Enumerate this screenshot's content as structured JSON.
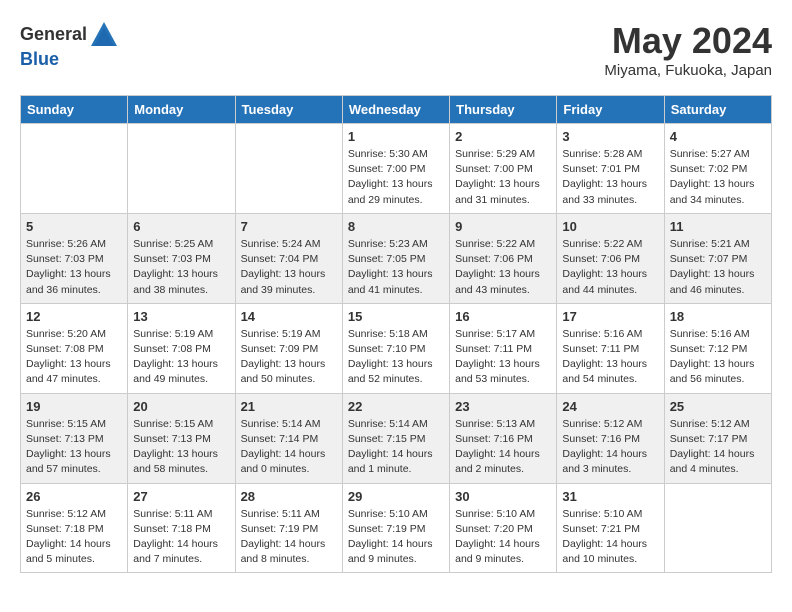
{
  "header": {
    "logo_general": "General",
    "logo_blue": "Blue",
    "month_year": "May 2024",
    "location": "Miyama, Fukuoka, Japan"
  },
  "weekdays": [
    "Sunday",
    "Monday",
    "Tuesday",
    "Wednesday",
    "Thursday",
    "Friday",
    "Saturday"
  ],
  "weeks": [
    [
      {
        "day": "",
        "content": ""
      },
      {
        "day": "",
        "content": ""
      },
      {
        "day": "",
        "content": ""
      },
      {
        "day": "1",
        "content": "Sunrise: 5:30 AM\nSunset: 7:00 PM\nDaylight: 13 hours\nand 29 minutes."
      },
      {
        "day": "2",
        "content": "Sunrise: 5:29 AM\nSunset: 7:00 PM\nDaylight: 13 hours\nand 31 minutes."
      },
      {
        "day": "3",
        "content": "Sunrise: 5:28 AM\nSunset: 7:01 PM\nDaylight: 13 hours\nand 33 minutes."
      },
      {
        "day": "4",
        "content": "Sunrise: 5:27 AM\nSunset: 7:02 PM\nDaylight: 13 hours\nand 34 minutes."
      }
    ],
    [
      {
        "day": "5",
        "content": "Sunrise: 5:26 AM\nSunset: 7:03 PM\nDaylight: 13 hours\nand 36 minutes."
      },
      {
        "day": "6",
        "content": "Sunrise: 5:25 AM\nSunset: 7:03 PM\nDaylight: 13 hours\nand 38 minutes."
      },
      {
        "day": "7",
        "content": "Sunrise: 5:24 AM\nSunset: 7:04 PM\nDaylight: 13 hours\nand 39 minutes."
      },
      {
        "day": "8",
        "content": "Sunrise: 5:23 AM\nSunset: 7:05 PM\nDaylight: 13 hours\nand 41 minutes."
      },
      {
        "day": "9",
        "content": "Sunrise: 5:22 AM\nSunset: 7:06 PM\nDaylight: 13 hours\nand 43 minutes."
      },
      {
        "day": "10",
        "content": "Sunrise: 5:22 AM\nSunset: 7:06 PM\nDaylight: 13 hours\nand 44 minutes."
      },
      {
        "day": "11",
        "content": "Sunrise: 5:21 AM\nSunset: 7:07 PM\nDaylight: 13 hours\nand 46 minutes."
      }
    ],
    [
      {
        "day": "12",
        "content": "Sunrise: 5:20 AM\nSunset: 7:08 PM\nDaylight: 13 hours\nand 47 minutes."
      },
      {
        "day": "13",
        "content": "Sunrise: 5:19 AM\nSunset: 7:08 PM\nDaylight: 13 hours\nand 49 minutes."
      },
      {
        "day": "14",
        "content": "Sunrise: 5:19 AM\nSunset: 7:09 PM\nDaylight: 13 hours\nand 50 minutes."
      },
      {
        "day": "15",
        "content": "Sunrise: 5:18 AM\nSunset: 7:10 PM\nDaylight: 13 hours\nand 52 minutes."
      },
      {
        "day": "16",
        "content": "Sunrise: 5:17 AM\nSunset: 7:11 PM\nDaylight: 13 hours\nand 53 minutes."
      },
      {
        "day": "17",
        "content": "Sunrise: 5:16 AM\nSunset: 7:11 PM\nDaylight: 13 hours\nand 54 minutes."
      },
      {
        "day": "18",
        "content": "Sunrise: 5:16 AM\nSunset: 7:12 PM\nDaylight: 13 hours\nand 56 minutes."
      }
    ],
    [
      {
        "day": "19",
        "content": "Sunrise: 5:15 AM\nSunset: 7:13 PM\nDaylight: 13 hours\nand 57 minutes."
      },
      {
        "day": "20",
        "content": "Sunrise: 5:15 AM\nSunset: 7:13 PM\nDaylight: 13 hours\nand 58 minutes."
      },
      {
        "day": "21",
        "content": "Sunrise: 5:14 AM\nSunset: 7:14 PM\nDaylight: 14 hours\nand 0 minutes."
      },
      {
        "day": "22",
        "content": "Sunrise: 5:14 AM\nSunset: 7:15 PM\nDaylight: 14 hours\nand 1 minute."
      },
      {
        "day": "23",
        "content": "Sunrise: 5:13 AM\nSunset: 7:16 PM\nDaylight: 14 hours\nand 2 minutes."
      },
      {
        "day": "24",
        "content": "Sunrise: 5:12 AM\nSunset: 7:16 PM\nDaylight: 14 hours\nand 3 minutes."
      },
      {
        "day": "25",
        "content": "Sunrise: 5:12 AM\nSunset: 7:17 PM\nDaylight: 14 hours\nand 4 minutes."
      }
    ],
    [
      {
        "day": "26",
        "content": "Sunrise: 5:12 AM\nSunset: 7:18 PM\nDaylight: 14 hours\nand 5 minutes."
      },
      {
        "day": "27",
        "content": "Sunrise: 5:11 AM\nSunset: 7:18 PM\nDaylight: 14 hours\nand 7 minutes."
      },
      {
        "day": "28",
        "content": "Sunrise: 5:11 AM\nSunset: 7:19 PM\nDaylight: 14 hours\nand 8 minutes."
      },
      {
        "day": "29",
        "content": "Sunrise: 5:10 AM\nSunset: 7:19 PM\nDaylight: 14 hours\nand 9 minutes."
      },
      {
        "day": "30",
        "content": "Sunrise: 5:10 AM\nSunset: 7:20 PM\nDaylight: 14 hours\nand 9 minutes."
      },
      {
        "day": "31",
        "content": "Sunrise: 5:10 AM\nSunset: 7:21 PM\nDaylight: 14 hours\nand 10 minutes."
      },
      {
        "day": "",
        "content": ""
      }
    ]
  ]
}
